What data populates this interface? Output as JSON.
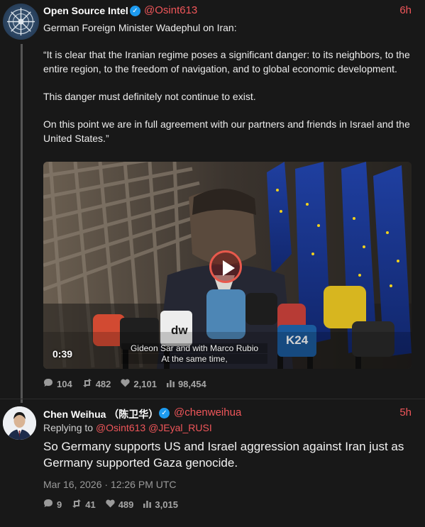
{
  "post1": {
    "author_name": "Open Source Intel",
    "handle": "@Osint613",
    "time_ago": "6h",
    "paragraphs": [
      "German Foreign Minister Wadephul on Iran:",
      "“It is clear that the Iranian regime poses a significant danger: to its neighbors, to the entire region, to the freedom of navigation, and to global economic development.",
      "This danger must definitely not continue to exist.",
      "On this point we are in full agreement with our partners and friends in Israel and the United States.”"
    ],
    "video": {
      "duration": "0:39",
      "subtitle_line1": "Gideon Sar and with Marco Rubio",
      "subtitle_line2": "At the same time,",
      "mic_labels": [
        "dw",
        "K24"
      ]
    },
    "stats": {
      "replies": "104",
      "reposts": "482",
      "likes": "2,101",
      "views": "98,454"
    }
  },
  "post2": {
    "author_name": "Chen Weihua （陈卫华）",
    "handle": "@chenweihua",
    "time_ago": "5h",
    "replying_label": "Replying to",
    "replying_handles": "@Osint613 @JEyal_RUSI",
    "text": "So Germany supports US and Israel aggression against Iran just as Germany supported Gaza genocide.",
    "timestamp": "Mar 16, 2026 · 12:26 PM UTC",
    "stats": {
      "replies": "9",
      "reposts": "41",
      "likes": "489",
      "views": "3,015"
    }
  },
  "colors": {
    "accent": "#f0565a",
    "verified": "#1d9bf0",
    "background": "#181818"
  },
  "icons": {
    "reply": "comment-icon",
    "repost": "repost-icon",
    "like": "heart-icon",
    "views": "bar-chart-icon"
  }
}
